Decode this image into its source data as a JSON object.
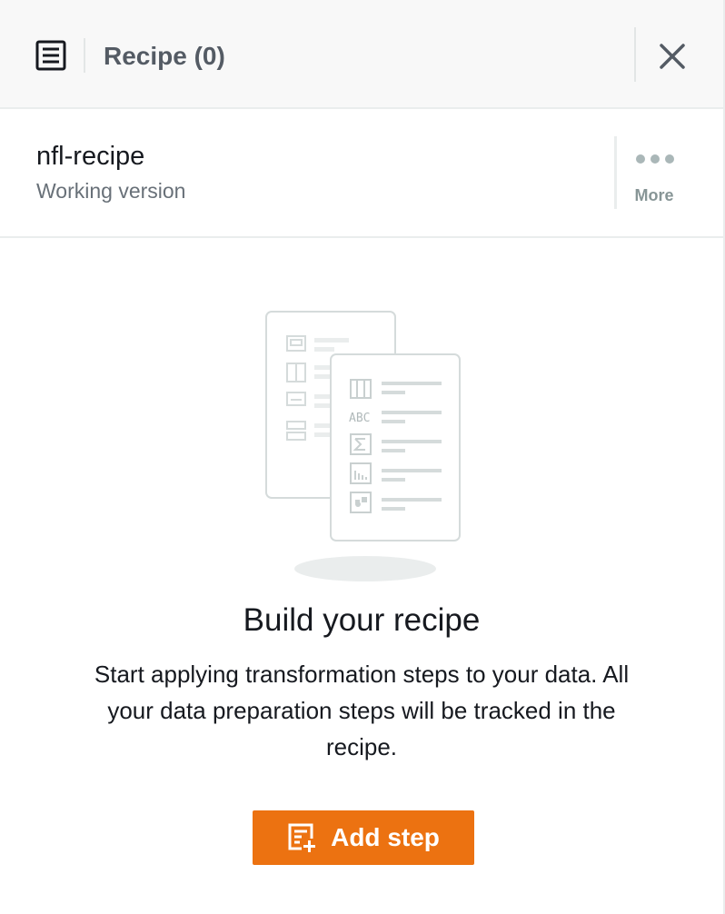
{
  "header": {
    "title": "Recipe (0)",
    "list_icon": "list-icon",
    "close_icon": "close-icon"
  },
  "recipe": {
    "name": "nfl-recipe",
    "version": "Working version",
    "more_label": "More",
    "more_icon": "ellipsis-icon"
  },
  "empty_state": {
    "illustration": "recipe-documents-illustration",
    "title": "Build your recipe",
    "description": "Start applying transformation steps to your data. All your data preparation steps will be tracked in the recipe.",
    "illustration_icon_label": "ABC"
  },
  "add_step_button": {
    "label": "Add step",
    "icon": "add-step-icon"
  },
  "colors": {
    "accent": "#ec7211",
    "header_bg": "#f8f8f8",
    "muted_text": "#687078"
  }
}
